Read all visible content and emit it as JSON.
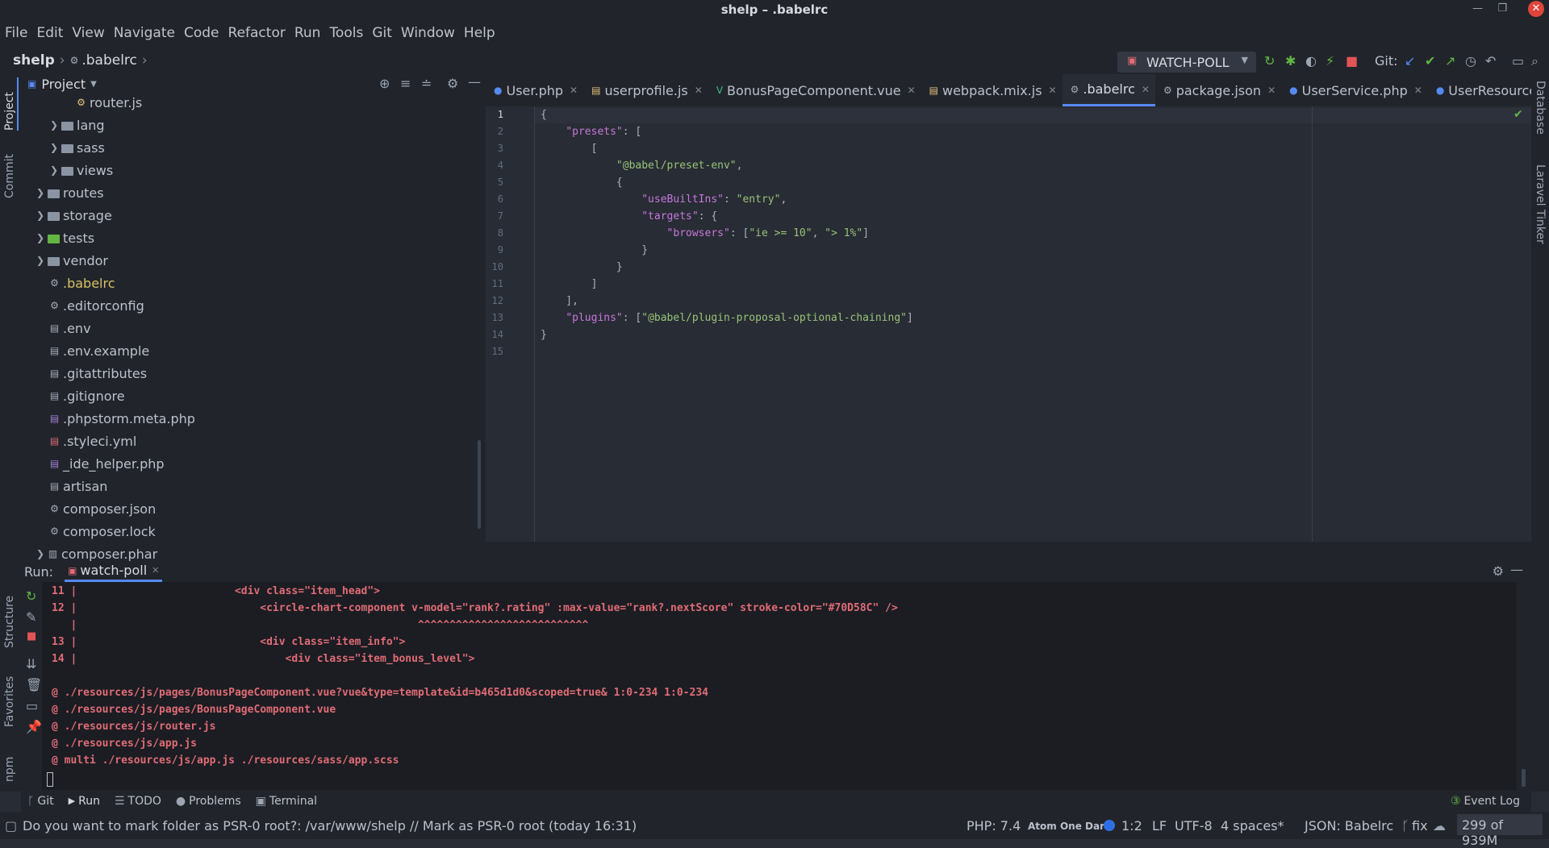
{
  "window": {
    "title": "shelp – .babelrc"
  },
  "menu": [
    "File",
    "Edit",
    "View",
    "Navigate",
    "Code",
    "Refactor",
    "Run",
    "Tools",
    "Git",
    "Window",
    "Help"
  ],
  "breadcrumb": {
    "project": "shelp",
    "file": ".babelrc"
  },
  "toolbar": {
    "run_config": "WATCH-POLL",
    "git_label": "Git:"
  },
  "left_strip": {
    "project": "Project",
    "commit": "Commit",
    "structure": "Structure",
    "favorites": "Favorites",
    "npm": "npm"
  },
  "right_strip": {
    "database": "Database",
    "tinker": "Laravel Tinker"
  },
  "project_panel": {
    "title": "Project",
    "items": [
      {
        "label": "router.js",
        "kind": "file",
        "expandable": false
      },
      {
        "label": "lang",
        "kind": "folder",
        "expandable": true
      },
      {
        "label": "sass",
        "kind": "folder",
        "expandable": true
      },
      {
        "label": "views",
        "kind": "folder",
        "expandable": true
      },
      {
        "label": "routes",
        "kind": "folder",
        "expandable": true
      },
      {
        "label": "storage",
        "kind": "folder",
        "expandable": true
      },
      {
        "label": "tests",
        "kind": "folder",
        "expandable": true
      },
      {
        "label": "vendor",
        "kind": "folder",
        "expandable": true
      },
      {
        "label": ".babelrc",
        "kind": "file",
        "expandable": false
      },
      {
        "label": ".editorconfig",
        "kind": "file",
        "expandable": false
      },
      {
        "label": ".env",
        "kind": "file",
        "expandable": false
      },
      {
        "label": ".env.example",
        "kind": "file",
        "expandable": false
      },
      {
        "label": ".gitattributes",
        "kind": "file",
        "expandable": false
      },
      {
        "label": ".gitignore",
        "kind": "file",
        "expandable": false
      },
      {
        "label": ".phpstorm.meta.php",
        "kind": "file",
        "expandable": false
      },
      {
        "label": ".styleci.yml",
        "kind": "file",
        "expandable": false
      },
      {
        "label": "_ide_helper.php",
        "kind": "file",
        "expandable": false
      },
      {
        "label": "artisan",
        "kind": "file",
        "expandable": false
      },
      {
        "label": "composer.json",
        "kind": "file",
        "expandable": false
      },
      {
        "label": "composer.lock",
        "kind": "file",
        "expandable": false
      },
      {
        "label": "composer.phar",
        "kind": "file",
        "expandable": true
      }
    ]
  },
  "editor_tabs": [
    {
      "label": "User.php",
      "active": false
    },
    {
      "label": "userprofile.js",
      "active": false
    },
    {
      "label": "BonusPageComponent.vue",
      "active": false
    },
    {
      "label": "webpack.mix.js",
      "active": false
    },
    {
      "label": ".babelrc",
      "active": true
    },
    {
      "label": "package.json",
      "active": false
    },
    {
      "label": "UserService.php",
      "active": false
    },
    {
      "label": "UserResource.p",
      "active": false
    }
  ],
  "code_lines": [
    {
      "n": "1",
      "segs": [
        [
          "p",
          "{"
        ]
      ]
    },
    {
      "n": "2",
      "segs": [
        [
          "p",
          "    "
        ],
        [
          "key",
          "\"presets\""
        ],
        [
          "p",
          ": ["
        ]
      ]
    },
    {
      "n": "3",
      "segs": [
        [
          "p",
          "        ["
        ]
      ]
    },
    {
      "n": "4",
      "segs": [
        [
          "p",
          "            "
        ],
        [
          "str",
          "\"@babel/preset-env\""
        ],
        [
          "p",
          ","
        ]
      ]
    },
    {
      "n": "5",
      "segs": [
        [
          "p",
          "            {"
        ]
      ]
    },
    {
      "n": "6",
      "segs": [
        [
          "p",
          "                "
        ],
        [
          "key",
          "\"useBuiltIns\""
        ],
        [
          "p",
          ": "
        ],
        [
          "str",
          "\"entry\""
        ],
        [
          "p",
          ","
        ]
      ]
    },
    {
      "n": "7",
      "segs": [
        [
          "p",
          "                "
        ],
        [
          "key",
          "\"targets\""
        ],
        [
          "p",
          ": {"
        ]
      ]
    },
    {
      "n": "8",
      "segs": [
        [
          "p",
          "                    "
        ],
        [
          "key",
          "\"browsers\""
        ],
        [
          "p",
          ": ["
        ],
        [
          "str",
          "\"ie >= 10\""
        ],
        [
          "p",
          ", "
        ],
        [
          "str",
          "\"> 1%\""
        ],
        [
          "p",
          "]"
        ]
      ]
    },
    {
      "n": "9",
      "segs": [
        [
          "p",
          "                }"
        ]
      ]
    },
    {
      "n": "10",
      "segs": [
        [
          "p",
          "            }"
        ]
      ]
    },
    {
      "n": "11",
      "segs": [
        [
          "p",
          "        ]"
        ]
      ]
    },
    {
      "n": "12",
      "segs": [
        [
          "p",
          "    ],"
        ]
      ]
    },
    {
      "n": "13",
      "segs": [
        [
          "p",
          "    "
        ],
        [
          "key",
          "\"plugins\""
        ],
        [
          "p",
          ": ["
        ],
        [
          "str",
          "\"@babel/plugin-proposal-optional-chaining\""
        ],
        [
          "p",
          "]"
        ]
      ]
    },
    {
      "n": "14",
      "segs": [
        [
          "p",
          "}"
        ]
      ]
    },
    {
      "n": "15",
      "segs": []
    }
  ],
  "run_panel": {
    "label": "Run:",
    "tab": "watch-poll"
  },
  "console_lines": [
    "11 |                         <div class=\"item_head\">",
    "12 |                             <circle-chart-component v-model=\"rank?.rating\" :max-value=\"rank?.nextScore\" stroke-color=\"#70D58C\" />",
    "   |                                                      ^^^^^^^^^^^^^^^^^^^^^^^^^^^",
    "13 |                             <div class=\"item_info\">",
    "14 |                                 <div class=\"item_bonus_level\">",
    "",
    "@ ./resources/js/pages/BonusPageComponent.vue?vue&type=template&id=b465d1d0&scoped=true& 1:0-234 1:0-234",
    "@ ./resources/js/pages/BonusPageComponent.vue",
    "@ ./resources/js/router.js",
    "@ ./resources/js/app.js",
    "@ multi ./resources/js/app.js ./resources/sass/app.scss"
  ],
  "bottom_tabs": [
    "Git",
    "Run",
    "TODO",
    "Problems",
    "Terminal"
  ],
  "event_log": "Event Log",
  "status": {
    "message": "Do you want to mark folder as PSR-0 root?: /var/www/shelp // Mark as PSR-0 root (today 16:31)",
    "php": "PHP: 7.4",
    "theme": "Atom One Dark",
    "position": "1:2",
    "line_sep": "LF",
    "encoding": "UTF-8",
    "indent": "4 spaces*",
    "schema": "JSON: Babelrc",
    "branch": "fix",
    "memory": "299 of 939M"
  },
  "colors": {
    "accent": "#568af2",
    "error": "#e06c75",
    "key": "#c678dd",
    "string": "#98c379"
  }
}
